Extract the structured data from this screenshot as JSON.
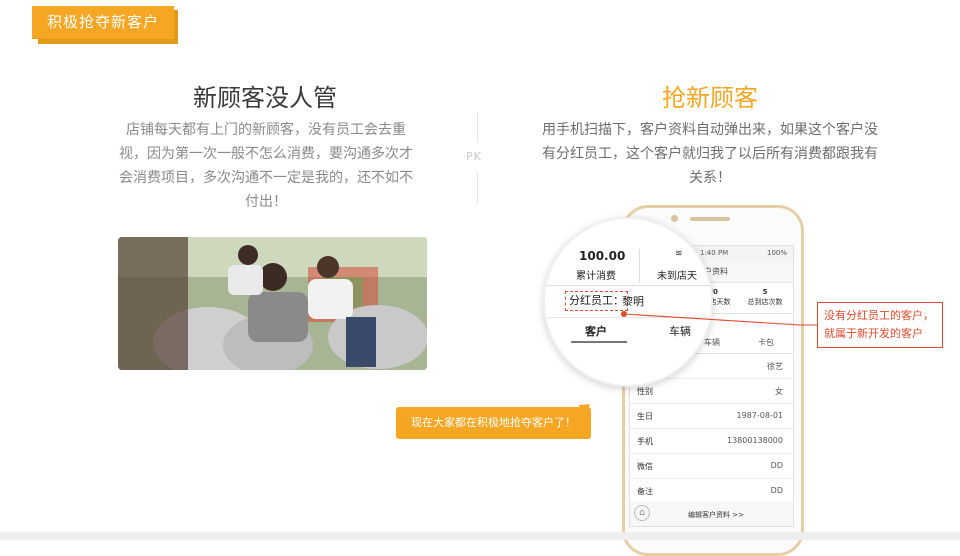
{
  "header": {
    "badge": "积极抢夺新客户"
  },
  "left": {
    "title": "新顾客没人管",
    "text": "店铺每天都有上门的新顾客，没有员工会去重视，因为第一次一般不怎么消费，要沟通多次才会消费项目，多次沟通不一定是我的，还不如不付出！"
  },
  "divider": {
    "label": "PK"
  },
  "right": {
    "title": "抢新顾客",
    "text": "用手机扫描下，客户资料自动弹出来，如果这个客户没有分红员工，这个客户就归我了以后所有消费都跟我有关系！"
  },
  "phone": {
    "status": {
      "time": "1:40 PM",
      "battery": "100%"
    },
    "header_title": "客户资料",
    "stats": [
      {
        "value": "20",
        "label": "未到店天数"
      },
      {
        "value": "5",
        "label": "总到店次数"
      }
    ],
    "tabs": {
      "vehicle": "车辆",
      "card": "卡包"
    },
    "name_value": "徐艺",
    "rows": [
      {
        "label": "性别",
        "value": "女"
      },
      {
        "label": "生日",
        "value": "1987-08-01"
      },
      {
        "label": "手机",
        "value": "13800138000"
      },
      {
        "label": "微信",
        "value": "DD"
      },
      {
        "label": "备注",
        "value": "DD"
      }
    ],
    "footer_link": "编辑客户资料 >>"
  },
  "magnifier": {
    "spend_value": "100.00",
    "spend_label": "累计消费",
    "away_label": "未到店天",
    "employee_label": "分红员工：",
    "employee_value": "黎明",
    "tab_customer": "客户",
    "tab_vehicle": "车辆"
  },
  "callouts": {
    "red_line1": "没有分红员工的客户，",
    "red_line2": "就属于新开发的客户",
    "orange": "现在大家都在积极地抢夺客户了！"
  },
  "colors": {
    "accent": "#f5a623",
    "alert": "#e04a2f"
  }
}
